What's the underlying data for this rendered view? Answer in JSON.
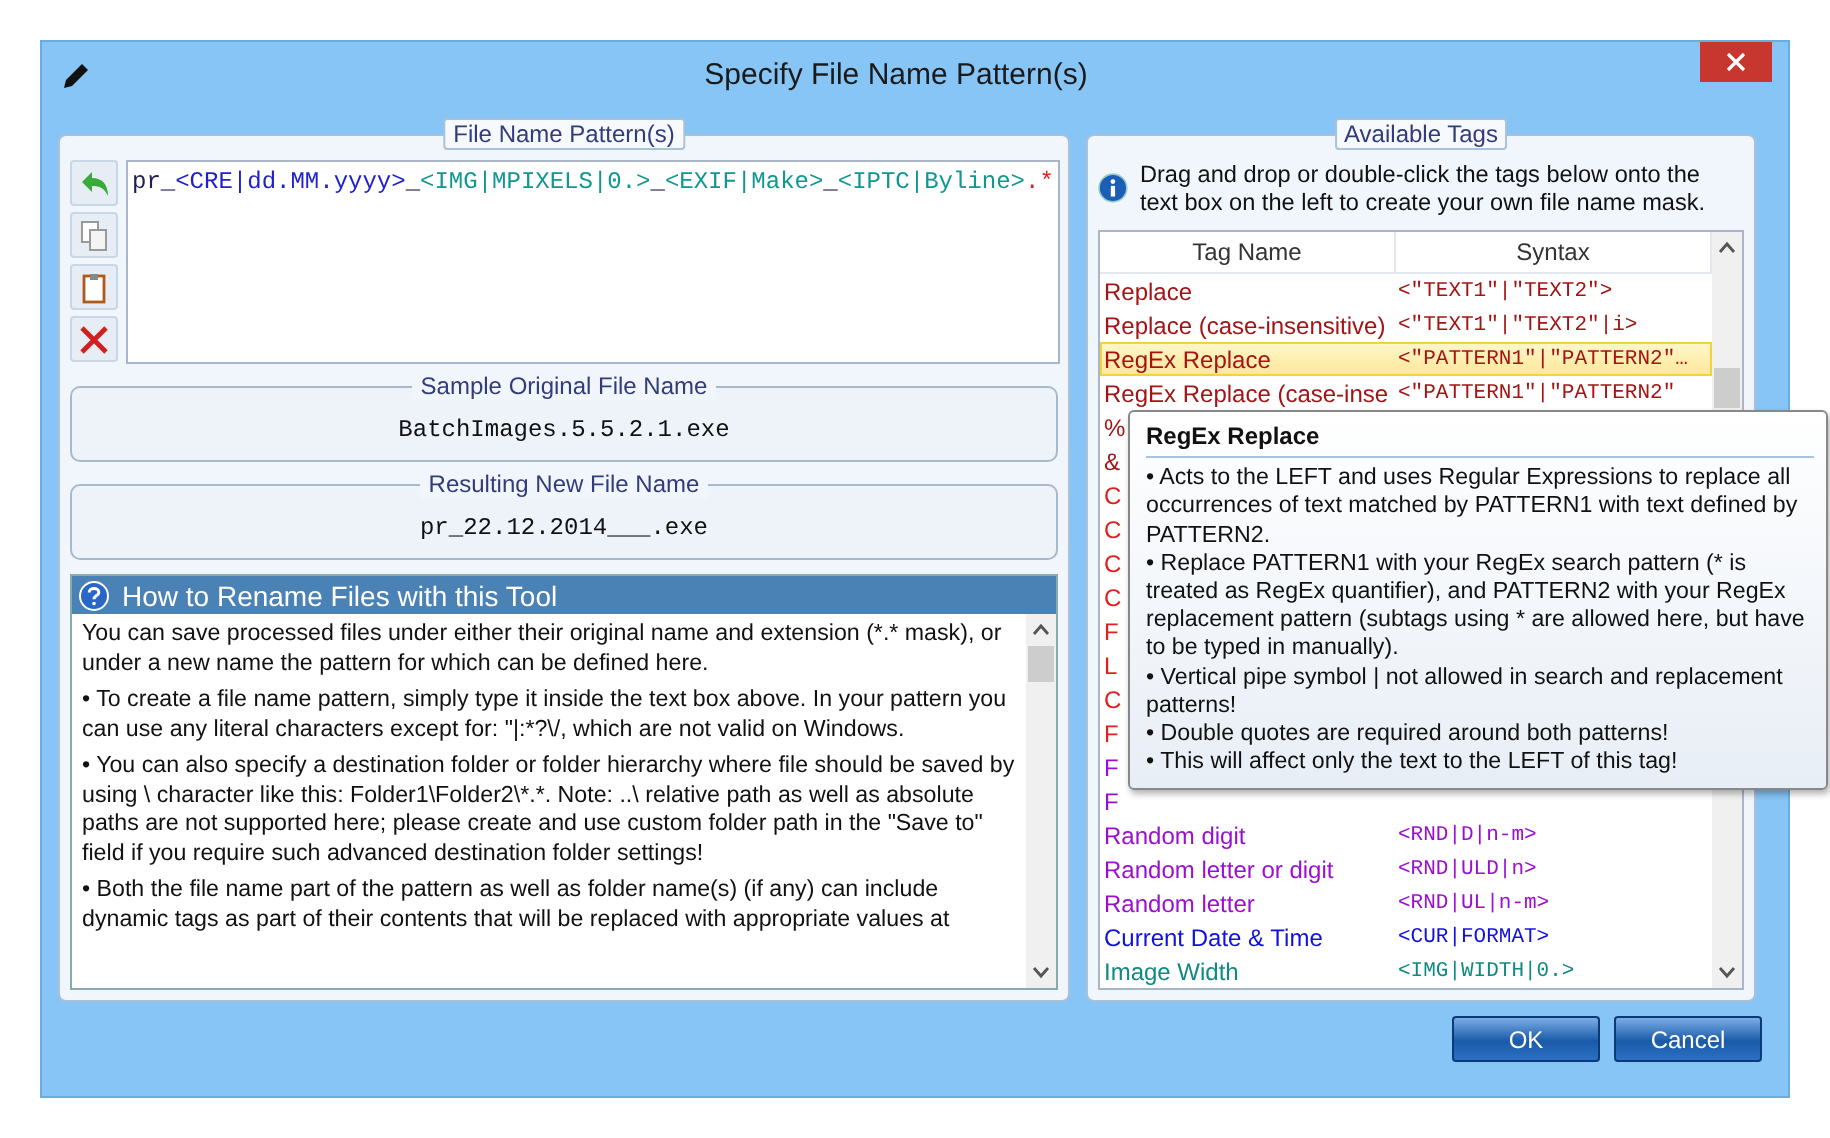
{
  "window": {
    "title": "Specify File Name Pattern(s)"
  },
  "pattern_group": {
    "title": "File Name Pattern(s)",
    "pattern": [
      {
        "kind": "literal",
        "text": "pr_"
      },
      {
        "kind": "date",
        "text": "<CRE|dd.MM.yyyy>"
      },
      {
        "kind": "literal",
        "text": "_"
      },
      {
        "kind": "tag",
        "text": "<IMG|MPIXELS|0.>"
      },
      {
        "kind": "literal",
        "text": "_"
      },
      {
        "kind": "tag",
        "text": "<EXIF|Make>"
      },
      {
        "kind": "literal",
        "text": "_"
      },
      {
        "kind": "tag",
        "text": "<IPTC|Byline>"
      },
      {
        "kind": "extension",
        "text": ".*"
      }
    ],
    "sample": {
      "title": "Sample Original File Name",
      "value": "BatchImages.5.5.2.1.exe"
    },
    "result": {
      "title": "Resulting New File Name",
      "value": "pr_22.12.2014___.exe"
    }
  },
  "help": {
    "title": "How to Rename Files with this Tool",
    "paragraphs": [
      "You can save processed files under either their original name and extension (*.* mask), or under a new name the pattern for which can be defined here.",
      "• To create a file name pattern, simply type it inside the text box above. In your pattern you can use any literal characters except for: \"|:*?\\/, which are not valid on Windows.",
      "• You can also specify a destination folder or folder hierarchy where file should be saved by using \\ character like this: Folder1\\Folder2\\*.*. Note: ..\\ relative path as well as absolute paths are not supported here; please create and use custom folder path in the \"Save to\" field if you require such advanced destination folder settings!",
      "• Both the file name part of the pattern as well as folder name(s) (if any) can include dynamic tags as part of their contents that will be replaced with appropriate values at"
    ]
  },
  "tags_group": {
    "title": "Available Tags",
    "info": "Drag and drop or double-click the tags below onto the text box on the left to create your own file name mask.",
    "columns": [
      "Tag Name",
      "Syntax"
    ],
    "rows": [
      {
        "name": "Replace",
        "syntax": "<\"TEXT1\"|\"TEXT2\">",
        "color": "#a31515",
        "selected": false
      },
      {
        "name": "Replace (case-insensitive)",
        "syntax": "<\"TEXT1\"|\"TEXT2\"|i>",
        "color": "#a31515",
        "selected": false
      },
      {
        "name": "RegEx Replace",
        "syntax": "<\"PATTERN1\"|\"PATTERN2\"…",
        "color": "#a31515",
        "selected": true
      },
      {
        "name": "RegEx Replace (case-inse",
        "syntax": "<\"PATTERN1\"|\"PATTERN2\"",
        "color": "#a31515",
        "selected": false
      },
      {
        "name": "%",
        "syntax": "",
        "color": "#a31515",
        "selected": false
      },
      {
        "name": "&",
        "syntax": "",
        "color": "#a31515",
        "selected": false
      },
      {
        "name": "C",
        "syntax": "",
        "color": "#e02020",
        "selected": false
      },
      {
        "name": "C",
        "syntax": "",
        "color": "#e02020",
        "selected": false
      },
      {
        "name": "C",
        "syntax": "",
        "color": "#e02020",
        "selected": false
      },
      {
        "name": "C",
        "syntax": "",
        "color": "#e02020",
        "selected": false
      },
      {
        "name": "F",
        "syntax": "",
        "color": "#e02020",
        "selected": false
      },
      {
        "name": "L",
        "syntax": "",
        "color": "#e02020",
        "selected": false
      },
      {
        "name": "C",
        "syntax": "",
        "color": "#e02020",
        "selected": false
      },
      {
        "name": "F",
        "syntax": "",
        "color": "#e02020",
        "selected": false
      },
      {
        "name": "F",
        "syntax": "",
        "color": "#9b10d0",
        "selected": false
      },
      {
        "name": "F",
        "syntax": "",
        "color": "#9b10d0",
        "selected": false
      },
      {
        "name": "Random digit",
        "syntax": "<RND|D|n-m>",
        "color": "#9b10d0",
        "selected": false
      },
      {
        "name": "Random letter or digit",
        "syntax": "<RND|ULD|n>",
        "color": "#9b10d0",
        "selected": false
      },
      {
        "name": "Random letter",
        "syntax": "<RND|UL|n-m>",
        "color": "#9b10d0",
        "selected": false
      },
      {
        "name": "Current Date & Time",
        "syntax": "<CUR|FORMAT>",
        "color": "#1010e0",
        "selected": false
      },
      {
        "name": "Image Width",
        "syntax": "<IMG|WIDTH|0.>",
        "color": "#108a80",
        "selected": false
      }
    ]
  },
  "tooltip": {
    "title": "RegEx Replace",
    "lines": [
      "• Acts to the LEFT and uses Regular Expressions to replace all occurrences of text matched by PATTERN1 with text defined by PATTERN2.",
      "• Replace PATTERN1 with your RegEx search pattern (* is treated as RegEx quantifier), and PATTERN2 with your RegEx replacement pattern (subtags using * are allowed here, but have to be typed in manually).",
      "• Vertical pipe symbol | not allowed in search and replacement patterns!",
      "• Double quotes are required around both patterns!",
      "• This will affect only the text to the LEFT of this tag!"
    ]
  },
  "buttons": [
    {
      "label": "OK"
    },
    {
      "label": "Cancel"
    }
  ]
}
